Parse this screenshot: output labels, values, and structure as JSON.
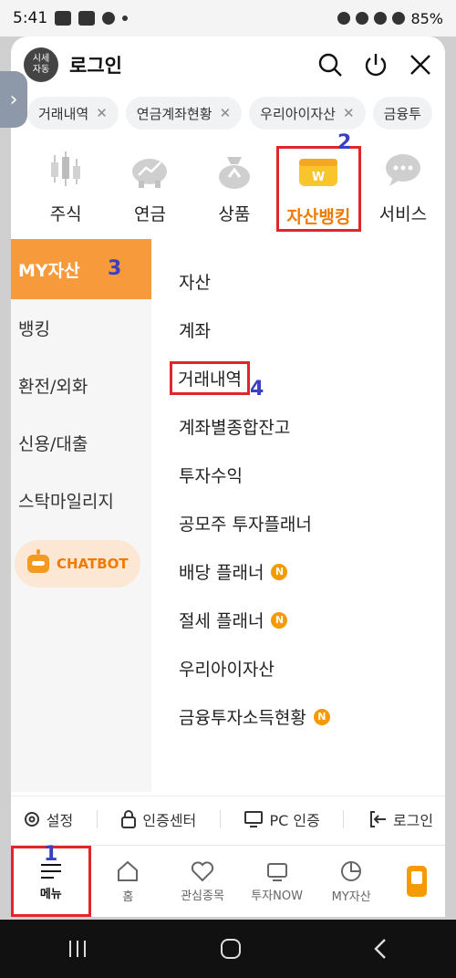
{
  "status_bar": {
    "time": "5:41",
    "battery": "85%"
  },
  "header": {
    "avatar_text": "시세\n자동",
    "title": "로그인"
  },
  "chips": [
    {
      "label": "거래내역"
    },
    {
      "label": "연금계좌현황"
    },
    {
      "label": "우리아이자산"
    },
    {
      "label": "금융투"
    }
  ],
  "categories": [
    {
      "label": "주식"
    },
    {
      "label": "연금"
    },
    {
      "label": "상품"
    },
    {
      "label": "자산뱅킹"
    },
    {
      "label": "서비스"
    }
  ],
  "annotations": {
    "a1": "1",
    "a2": "2",
    "a3": "3",
    "a4": "4"
  },
  "left_nav": [
    {
      "label": "MY자산"
    },
    {
      "label": "뱅킹"
    },
    {
      "label": "환전/외화"
    },
    {
      "label": "신용/대출"
    },
    {
      "label": "스탁마일리지"
    }
  ],
  "chatbot_label": "CHATBOT",
  "right_list": [
    {
      "label": "자산"
    },
    {
      "label": "계좌"
    },
    {
      "label": "거래내역"
    },
    {
      "label": "계좌별종합잔고"
    },
    {
      "label": "투자수익"
    },
    {
      "label": "공모주 투자플래너"
    },
    {
      "label": "배당 플래너",
      "badge": "N"
    },
    {
      "label": "절세 플래너",
      "badge": "N"
    },
    {
      "label": "우리아이자산"
    },
    {
      "label": "금융투자소득현황",
      "badge": "N"
    }
  ],
  "bottom_links": [
    {
      "label": "설정"
    },
    {
      "label": "인증센터"
    },
    {
      "label": "PC 인증"
    },
    {
      "label": "로그인"
    }
  ],
  "tabbar": [
    {
      "label": "메뉴"
    },
    {
      "label": "홈"
    },
    {
      "label": "관심종목"
    },
    {
      "label": "투자NOW"
    },
    {
      "label": "MY자산"
    }
  ],
  "colors": {
    "accent": "#f07a00",
    "active_left": "#f79a3c",
    "highlight": "#e0252b",
    "annotation": "#3b3fc2"
  }
}
